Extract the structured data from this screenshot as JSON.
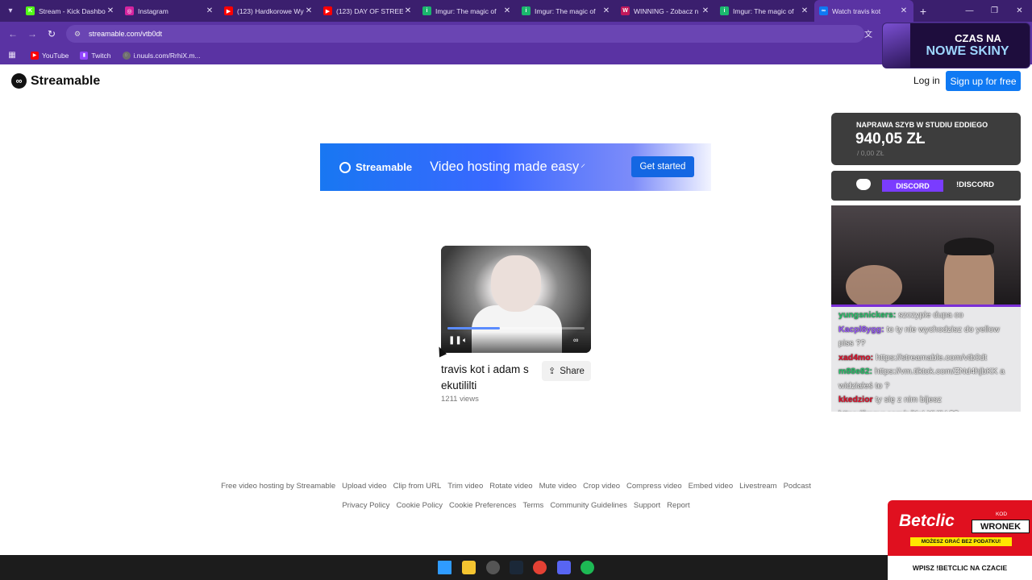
{
  "browser": {
    "tabs": [
      {
        "title": "Stream - Kick Dashbo",
        "favicon": "K",
        "color": "#53fc18"
      },
      {
        "title": "Instagram",
        "favicon": "◎",
        "color": "#d6249f"
      },
      {
        "title": "(123) Hardkorowe Wy",
        "favicon": "▶",
        "color": "#ff0000"
      },
      {
        "title": "(123) DAY OF STREET",
        "favicon": "▶",
        "color": "#ff0000"
      },
      {
        "title": "Imgur: The magic of",
        "favicon": "i",
        "color": "#1bb76e"
      },
      {
        "title": "Imgur: The magic of",
        "favicon": "i",
        "color": "#1bb76e"
      },
      {
        "title": "WINNING - Zobacz n",
        "favicon": "W",
        "color": "#c2185b"
      },
      {
        "title": "Imgur: The magic of",
        "favicon": "i",
        "color": "#1bb76e"
      },
      {
        "title": "Watch travis kot",
        "favicon": "∞",
        "color": "#0f79f3"
      }
    ],
    "url": "streamable.com/vtb0dt",
    "bookmarks": [
      {
        "label": "YouTube",
        "icon": "youtube-icon"
      },
      {
        "label": "Twitch",
        "icon": "twitch-icon"
      },
      {
        "label": "i.nuuls.com/RrhiX.m...",
        "icon": "globe-icon"
      }
    ]
  },
  "overlay_skins": {
    "line1": "CZAS NA",
    "line2": "NOWE SKINY"
  },
  "header": {
    "brand": "Streamable",
    "login": "Log in",
    "signup": "Sign up for free"
  },
  "ad_banner": {
    "brand": "Streamable",
    "headline": "Video hosting made easy",
    "cta": "Get started"
  },
  "video": {
    "title": "travis kot i adam s ekutililti",
    "views": "1211 views",
    "share": "Share",
    "progress": 0.38
  },
  "footer": {
    "row1": [
      "Free video hosting by Streamable",
      "Upload video",
      "Clip from URL",
      "Trim video",
      "Rotate video",
      "Mute video",
      "Crop video",
      "Compress video",
      "Embed video",
      "Livestream",
      "Podcast"
    ],
    "row2": [
      "Privacy Policy",
      "Cookie Policy",
      "Cookie Preferences",
      "Terms",
      "Community Guidelines",
      "Support",
      "Report"
    ]
  },
  "donation_goal": {
    "title": "NAPRAWA SZYB W STUDIU EDDIEGO",
    "amount": "940,05 ZŁ",
    "sub": "/ 0,00 ZŁ"
  },
  "discord_widget": {
    "label": "DISCORD",
    "command": "!DISCORD"
  },
  "chat": [
    {
      "user": "yungsnickers:",
      "text": "szczypie dupa co",
      "color": "#27c46b"
    },
    {
      "user": "Kacpl8ygg:",
      "text": "to ty nie wychodzisz do yellow piss ??",
      "color": "#9b59ff"
    },
    {
      "user": "xad4mo:",
      "text": "https://streamable.com/vtb0dt",
      "color": "#e0102c"
    },
    {
      "user": "m88e82:",
      "text": "https://vm.tiktok.com/ZNd4hjbKK a widziałeś to ?",
      "color": "#27c46b"
    },
    {
      "user": "kkedzior",
      "text": "ty się z nim bijesz https://imgur.com/a/KsLXHIV ??",
      "color": "#e0102c"
    }
  ],
  "betclic": {
    "brand": "Betclic",
    "kod_label": "KOD",
    "code": "WRONEK",
    "strip": "MOŻESZ GRAĆ BEZ PODATKU!",
    "footer": "WPISZ !BETCLIC NA CZACIE"
  },
  "taskbar": [
    {
      "icon": "windows-start-icon",
      "color": "#2f9bff"
    },
    {
      "icon": "file-explorer-icon",
      "color": "#f4c430"
    },
    {
      "icon": "obs-icon",
      "color": "#555555"
    },
    {
      "icon": "steam-icon",
      "color": "#1b2838"
    },
    {
      "icon": "chrome-icon",
      "color": "#e44134"
    },
    {
      "icon": "discord-icon",
      "color": "#5865f2"
    },
    {
      "icon": "spotify-icon",
      "color": "#1db954"
    }
  ]
}
